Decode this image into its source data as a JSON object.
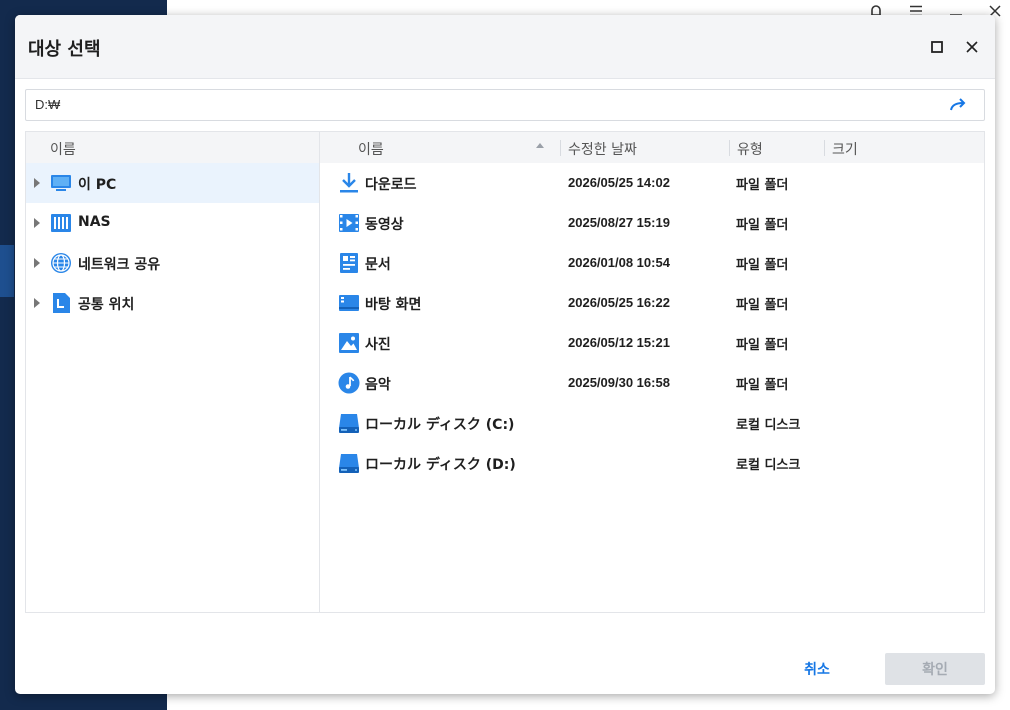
{
  "dialog": {
    "title": "대상 선택",
    "path": "D:₩",
    "cancel_label": "취소",
    "ok_label": "확인"
  },
  "tree": {
    "header": "이름",
    "items": [
      {
        "label": "이 PC",
        "icon": "monitor-icon",
        "selected": true
      },
      {
        "label": "NAS",
        "icon": "nas-icon"
      },
      {
        "label": "네트워크 공유",
        "icon": "globe-icon"
      },
      {
        "label": "공통 위치",
        "icon": "location-icon"
      }
    ]
  },
  "files": {
    "headers": {
      "name": "이름",
      "modified": "수정한 날짜",
      "type": "유형",
      "size": "크기"
    },
    "rows": [
      {
        "name": "다운로드",
        "modified": "2026/05/25 14:02",
        "type": "파일 폴더",
        "icon": "download-icon"
      },
      {
        "name": "동영상",
        "modified": "2025/08/27 15:19",
        "type": "파일 폴더",
        "icon": "video-icon"
      },
      {
        "name": "문서",
        "modified": "2026/01/08 10:54",
        "type": "파일 폴더",
        "icon": "document-icon"
      },
      {
        "name": "바탕 화면",
        "modified": "2026/05/25 16:22",
        "type": "파일 폴더",
        "icon": "desktop-icon"
      },
      {
        "name": "사진",
        "modified": "2026/05/12 15:21",
        "type": "파일 폴더",
        "icon": "picture-icon"
      },
      {
        "name": "음악",
        "modified": "2025/09/30 16:58",
        "type": "파일 폴더",
        "icon": "music-icon"
      },
      {
        "name": "ローカル ディスク (C:)",
        "modified": "",
        "type": "로컬 디스크",
        "icon": "drive-icon"
      },
      {
        "name": "ローカル ディスク (D:)",
        "modified": "",
        "type": "로컬 디스크",
        "icon": "drive-icon"
      }
    ]
  },
  "colors": {
    "accent": "#1677e5",
    "icon_blue": "#2a86e8",
    "sidebar": "#132a4d"
  }
}
